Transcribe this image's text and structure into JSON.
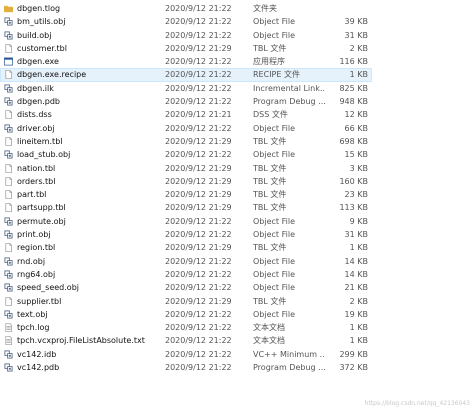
{
  "files": [
    {
      "name": "dbgen.tlog",
      "date": "2020/9/12 21:22",
      "type": "文件夹",
      "size": "",
      "icon": "folder-icon",
      "selected": false
    },
    {
      "name": "bm_utils.obj",
      "date": "2020/9/12 21:22",
      "type": "Object File",
      "size": "39 KB",
      "icon": "object-file-icon",
      "selected": false
    },
    {
      "name": "build.obj",
      "date": "2020/9/12 21:22",
      "type": "Object File",
      "size": "31 KB",
      "icon": "object-file-icon",
      "selected": false
    },
    {
      "name": "customer.tbl",
      "date": "2020/9/12 21:29",
      "type": "TBL 文件",
      "size": "2 KB",
      "icon": "document-icon",
      "selected": false
    },
    {
      "name": "dbgen.exe",
      "date": "2020/9/12 21:22",
      "type": "应用程序",
      "size": "116 KB",
      "icon": "application-icon",
      "selected": false
    },
    {
      "name": "dbgen.exe.recipe",
      "date": "2020/9/12 21:22",
      "type": "RECIPE 文件",
      "size": "1 KB",
      "icon": "document-icon",
      "selected": true
    },
    {
      "name": "dbgen.ilk",
      "date": "2020/9/12 21:22",
      "type": "Incremental Link...",
      "size": "825 KB",
      "icon": "object-file-icon",
      "selected": false
    },
    {
      "name": "dbgen.pdb",
      "date": "2020/9/12 21:22",
      "type": "Program Debug ...",
      "size": "948 KB",
      "icon": "object-file-icon",
      "selected": false
    },
    {
      "name": "dists.dss",
      "date": "2020/9/12 21:21",
      "type": "DSS 文件",
      "size": "12 KB",
      "icon": "document-icon",
      "selected": false
    },
    {
      "name": "driver.obj",
      "date": "2020/9/12 21:22",
      "type": "Object File",
      "size": "66 KB",
      "icon": "object-file-icon",
      "selected": false
    },
    {
      "name": "lineitem.tbl",
      "date": "2020/9/12 21:29",
      "type": "TBL 文件",
      "size": "698 KB",
      "icon": "document-icon",
      "selected": false
    },
    {
      "name": "load_stub.obj",
      "date": "2020/9/12 21:22",
      "type": "Object File",
      "size": "15 KB",
      "icon": "object-file-icon",
      "selected": false
    },
    {
      "name": "nation.tbl",
      "date": "2020/9/12 21:29",
      "type": "TBL 文件",
      "size": "3 KB",
      "icon": "document-icon",
      "selected": false
    },
    {
      "name": "orders.tbl",
      "date": "2020/9/12 21:29",
      "type": "TBL 文件",
      "size": "160 KB",
      "icon": "document-icon",
      "selected": false
    },
    {
      "name": "part.tbl",
      "date": "2020/9/12 21:29",
      "type": "TBL 文件",
      "size": "23 KB",
      "icon": "document-icon",
      "selected": false
    },
    {
      "name": "partsupp.tbl",
      "date": "2020/9/12 21:29",
      "type": "TBL 文件",
      "size": "113 KB",
      "icon": "document-icon",
      "selected": false
    },
    {
      "name": "permute.obj",
      "date": "2020/9/12 21:22",
      "type": "Object File",
      "size": "9 KB",
      "icon": "object-file-icon",
      "selected": false
    },
    {
      "name": "print.obj",
      "date": "2020/9/12 21:22",
      "type": "Object File",
      "size": "31 KB",
      "icon": "object-file-icon",
      "selected": false
    },
    {
      "name": "region.tbl",
      "date": "2020/9/12 21:29",
      "type": "TBL 文件",
      "size": "1 KB",
      "icon": "document-icon",
      "selected": false
    },
    {
      "name": "rnd.obj",
      "date": "2020/9/12 21:22",
      "type": "Object File",
      "size": "14 KB",
      "icon": "object-file-icon",
      "selected": false
    },
    {
      "name": "rng64.obj",
      "date": "2020/9/12 21:22",
      "type": "Object File",
      "size": "14 KB",
      "icon": "object-file-icon",
      "selected": false
    },
    {
      "name": "speed_seed.obj",
      "date": "2020/9/12 21:22",
      "type": "Object File",
      "size": "21 KB",
      "icon": "object-file-icon",
      "selected": false
    },
    {
      "name": "supplier.tbl",
      "date": "2020/9/12 21:29",
      "type": "TBL 文件",
      "size": "2 KB",
      "icon": "document-icon",
      "selected": false
    },
    {
      "name": "text.obj",
      "date": "2020/9/12 21:22",
      "type": "Object File",
      "size": "19 KB",
      "icon": "object-file-icon",
      "selected": false
    },
    {
      "name": "tpch.log",
      "date": "2020/9/12 21:22",
      "type": "文本文档",
      "size": "1 KB",
      "icon": "text-document-icon",
      "selected": false
    },
    {
      "name": "tpch.vcxproj.FileListAbsolute.txt",
      "date": "2020/9/12 21:22",
      "type": "文本文档",
      "size": "1 KB",
      "icon": "text-document-icon",
      "selected": false
    },
    {
      "name": "vc142.idb",
      "date": "2020/9/12 21:22",
      "type": "VC++ Minimum ...",
      "size": "299 KB",
      "icon": "object-file-icon",
      "selected": false
    },
    {
      "name": "vc142.pdb",
      "date": "2020/9/12 21:22",
      "type": "Program Debug ...",
      "size": "372 KB",
      "icon": "object-file-icon",
      "selected": false
    }
  ],
  "watermark": "https://blog.csdn.net/qq_42136043",
  "colors": {
    "folder": "#e8b84a",
    "folder_dark": "#d39f2a",
    "object_file": "#5a6e8c",
    "application": "#2b5797",
    "document_border": "#9a9a9a",
    "selection_bg": "#e5f1fb"
  }
}
